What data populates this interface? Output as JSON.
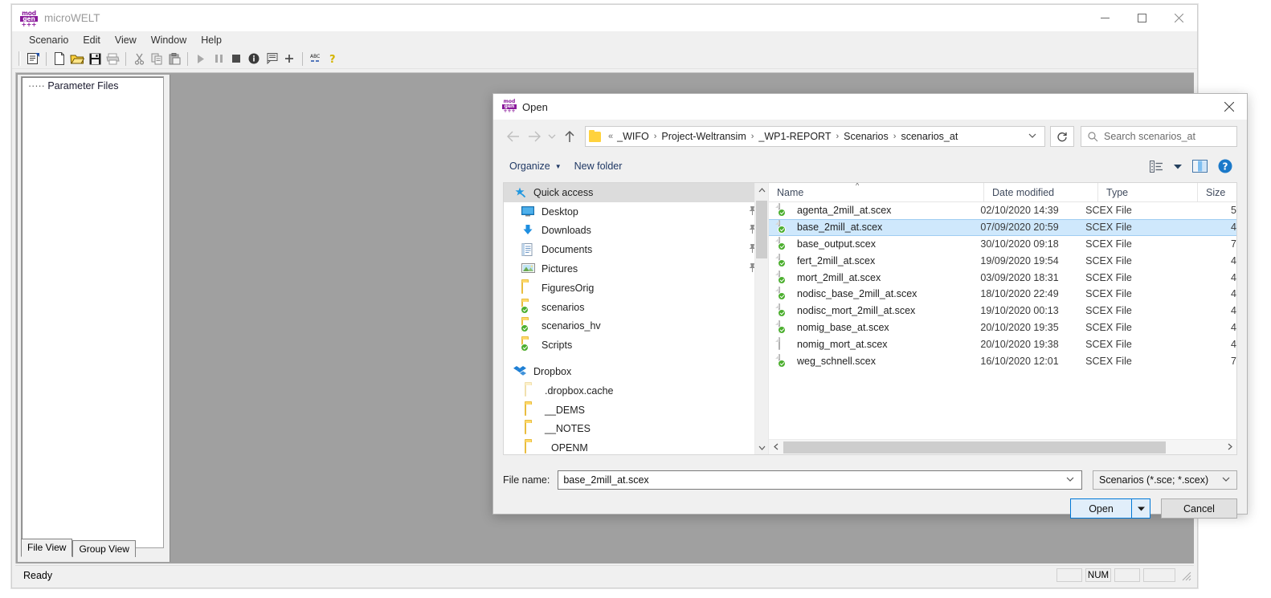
{
  "app": {
    "title": "microWELT",
    "logo": {
      "line1": "mod",
      "line2": "gen",
      "line3": "+++"
    },
    "menu": [
      "Scenario",
      "Edit",
      "View",
      "Window",
      "Help"
    ],
    "window_controls": [
      "minimize",
      "maximize",
      "close"
    ],
    "toolbar_icons": [
      "properties-icon",
      "new-icon",
      "open-icon",
      "save-icon",
      "print-icon",
      "cut-icon",
      "copy-icon",
      "paste-icon",
      "run-icon",
      "pause-icon",
      "stop-icon",
      "info-icon",
      "log-icon",
      "add-icon",
      "spellcheck-icon",
      "help-icon"
    ],
    "tree": {
      "root_label": "Parameter Files",
      "prefix": "·····"
    },
    "view_tabs": [
      {
        "label": "File View",
        "active": true
      },
      {
        "label": "Group View",
        "active": false
      }
    ],
    "status": {
      "text": "Ready",
      "indicators": [
        "",
        "NUM",
        "",
        ""
      ]
    }
  },
  "dialog": {
    "title": "Open",
    "logo": {
      "line1": "mod",
      "line2": "gen",
      "line3": "+++"
    },
    "close_icon": "close-icon",
    "nav": {
      "back_icon": "back-arrow-icon",
      "forward_icon": "forward-arrow-icon",
      "recent_icon": "chevron-down-icon",
      "up_icon": "up-arrow-icon",
      "breadcrumb_overflow": "«",
      "breadcrumb": [
        "_WIFO",
        "Project-Weltransim",
        "_WP1-REPORT",
        "Scenarios",
        "scenarios_at"
      ],
      "breadcrumb_dropdown_icon": "chevron-down-icon",
      "refresh_icon": "refresh-icon",
      "search_placeholder": "Search scenarios_at",
      "search_icon": "search-icon"
    },
    "commands": {
      "organize": "Organize",
      "new_folder": "New folder",
      "view_icon": "view-layout-icon",
      "view_caret_icon": "chevron-down-icon",
      "preview_icon": "preview-pane-icon",
      "help_icon": "help-icon"
    },
    "nav_pane": {
      "groups": [
        {
          "root": {
            "label": "Quick access",
            "icon": "quick-access-star-icon",
            "selected": true
          },
          "items": [
            {
              "label": "Desktop",
              "icon": "desktop-icon",
              "pinned": true
            },
            {
              "label": "Downloads",
              "icon": "downloads-icon",
              "pinned": true
            },
            {
              "label": "Documents",
              "icon": "documents-icon",
              "pinned": true
            },
            {
              "label": "Pictures",
              "icon": "pictures-icon",
              "pinned": true
            },
            {
              "label": "FiguresOrig",
              "icon": "folder-icon",
              "pinned": false
            },
            {
              "label": "scenarios",
              "icon": "folder-sync-icon",
              "pinned": false
            },
            {
              "label": "scenarios_hv",
              "icon": "folder-sync-icon",
              "pinned": false
            },
            {
              "label": "Scripts",
              "icon": "folder-sync-icon",
              "pinned": false
            }
          ]
        },
        {
          "root": {
            "label": "Dropbox",
            "icon": "dropbox-icon",
            "selected": false
          },
          "items": [
            {
              "label": ".dropbox.cache",
              "icon": "folder-pale-icon",
              "pinned": false
            },
            {
              "label": "__DEMS",
              "icon": "folder-icon",
              "pinned": false
            },
            {
              "label": "__NOTES",
              "icon": "folder-icon",
              "pinned": false
            },
            {
              "label": "OPENM",
              "icon": "folder-icon",
              "pinned": false
            }
          ]
        }
      ]
    },
    "file_list": {
      "columns": [
        "Name",
        "Date modified",
        "Type",
        "Size"
      ],
      "sort_column": "Name",
      "sort_direction": "ascending",
      "rows": [
        {
          "name": "agenta_2mill_at.scex",
          "date": "02/10/2020 14:39",
          "type": "SCEX File",
          "size": "5",
          "selected": false,
          "synced": true
        },
        {
          "name": "base_2mill_at.scex",
          "date": "07/09/2020 20:59",
          "type": "SCEX File",
          "size": "4",
          "selected": true,
          "synced": true
        },
        {
          "name": "base_output.scex",
          "date": "30/10/2020 09:18",
          "type": "SCEX File",
          "size": "7",
          "selected": false,
          "synced": true
        },
        {
          "name": "fert_2mill_at.scex",
          "date": "19/09/2020 19:54",
          "type": "SCEX File",
          "size": "4",
          "selected": false,
          "synced": true
        },
        {
          "name": "mort_2mill_at.scex",
          "date": "03/09/2020 18:31",
          "type": "SCEX File",
          "size": "4",
          "selected": false,
          "synced": true
        },
        {
          "name": "nodisc_base_2mill_at.scex",
          "date": "18/10/2020 22:49",
          "type": "SCEX File",
          "size": "4",
          "selected": false,
          "synced": true
        },
        {
          "name": "nodisc_mort_2mill_at.scex",
          "date": "19/10/2020 00:13",
          "type": "SCEX File",
          "size": "4",
          "selected": false,
          "synced": true
        },
        {
          "name": "nomig_base_at.scex",
          "date": "20/10/2020 19:35",
          "type": "SCEX File",
          "size": "4",
          "selected": false,
          "synced": true
        },
        {
          "name": "nomig_mort_at.scex",
          "date": "20/10/2020 19:38",
          "type": "SCEX File",
          "size": "4",
          "selected": false,
          "synced": false
        },
        {
          "name": "weg_schnell.scex",
          "date": "16/10/2020 12:01",
          "type": "SCEX File",
          "size": "7",
          "selected": false,
          "synced": true
        }
      ]
    },
    "footer": {
      "filename_label": "File name:",
      "filename_value": "base_2mill_at.scex",
      "filter_value": "Scenarios (*.sce; *.scex)",
      "open_label": "Open",
      "cancel_label": "Cancel"
    }
  },
  "colors": {
    "accent": "#0078d7",
    "selection": "#cfe8fc",
    "logo": "#8a1a9b",
    "folder": "#ffd96b",
    "sync": "#4caf2f"
  }
}
